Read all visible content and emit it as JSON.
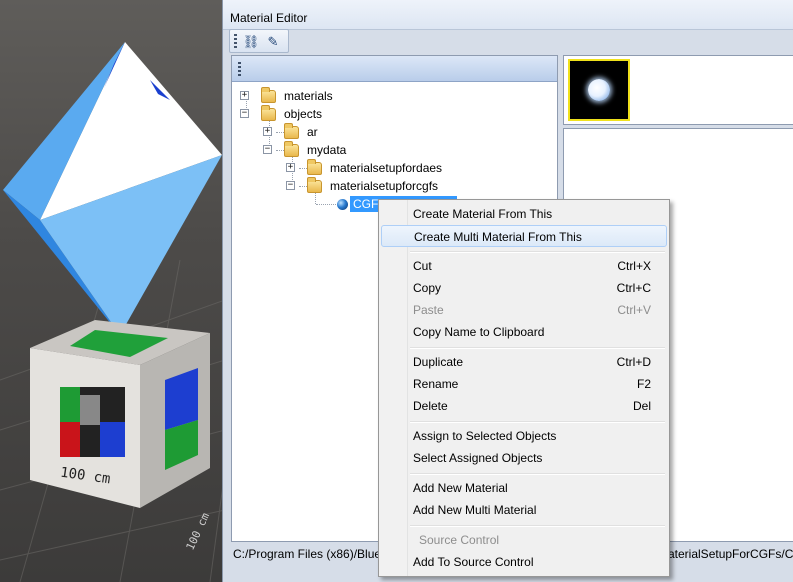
{
  "viewport": {
    "cube_label": "100 cm",
    "ground_label": "100 cm"
  },
  "window": {
    "title": "Material Editor"
  },
  "toolbar": {
    "icons": [
      "select-objects-icon",
      "pick-material-icon"
    ]
  },
  "tree": {
    "nodes": [
      {
        "label": "materials",
        "expander": "+"
      },
      {
        "label": "objects",
        "expander": "−"
      },
      {
        "label": "ar",
        "expander": "+"
      },
      {
        "label": "mydata",
        "expander": "−"
      },
      {
        "label": "materialsetupfordaes",
        "expander": "+"
      },
      {
        "label": "materialsetupforcgfs",
        "expander": "−"
      }
    ],
    "selected_item": "CGF_Example_MTL"
  },
  "status": {
    "path_left": "C:/Program Files (x86)/Blue",
    "path_right": "aterialSetupForCGFs/CGF_"
  },
  "context_menu": {
    "items": [
      {
        "label": "Create Material From This",
        "shortcut": ""
      },
      {
        "label": "Create Multi Material From This",
        "shortcut": ""
      },
      {
        "label": "Cut",
        "shortcut": "Ctrl+X"
      },
      {
        "label": "Copy",
        "shortcut": "Ctrl+C"
      },
      {
        "label": "Paste",
        "shortcut": "Ctrl+V"
      },
      {
        "label": "Copy Name to Clipboard",
        "shortcut": ""
      },
      {
        "label": "Duplicate",
        "shortcut": "Ctrl+D"
      },
      {
        "label": "Rename",
        "shortcut": "F2"
      },
      {
        "label": "Delete",
        "shortcut": "Del"
      },
      {
        "label": "Assign to Selected Objects",
        "shortcut": ""
      },
      {
        "label": "Select Assigned Objects",
        "shortcut": ""
      },
      {
        "label": "Add New Material",
        "shortcut": ""
      },
      {
        "label": "Add New Multi Material",
        "shortcut": ""
      },
      {
        "label": "Source Control",
        "shortcut": ""
      },
      {
        "label": "Add To Source Control",
        "shortcut": ""
      }
    ],
    "hovered": "Create Multi Material From This",
    "disabled": [
      "Paste",
      "Source Control"
    ]
  },
  "colors": {
    "selection": "#3399ff",
    "thumbnail_border": "#f0e11c",
    "menu_hover": "#dce9f8"
  }
}
